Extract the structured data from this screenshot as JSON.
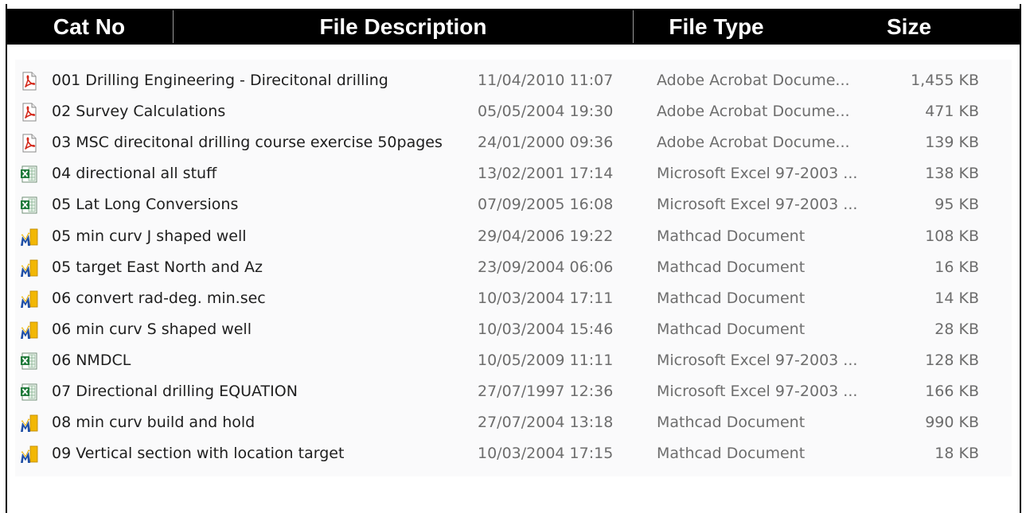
{
  "header": {
    "clipped_title": "",
    "columns": [
      "Cat No",
      "File Description",
      "File Type",
      "Size"
    ]
  },
  "files": [
    {
      "icon": "pdf-icon",
      "name": "001 Drilling Engineering - Direcitonal drilling",
      "date": "11/04/2010 11:07",
      "type": "Adobe Acrobat Docume...",
      "size": "1,455 KB"
    },
    {
      "icon": "pdf-icon",
      "name": "02 Survey Calculations",
      "date": "05/05/2004 19:30",
      "type": "Adobe Acrobat Docume...",
      "size": "471 KB"
    },
    {
      "icon": "pdf-icon",
      "name": "03 MSC direcitonal drilling course exercise 50pages",
      "date": "24/01/2000 09:36",
      "type": "Adobe Acrobat Docume...",
      "size": "139 KB"
    },
    {
      "icon": "excel-icon",
      "name": "04 directional all stuff",
      "date": "13/02/2001 17:14",
      "type": "Microsoft Excel 97-2003 ...",
      "size": "138 KB"
    },
    {
      "icon": "excel-icon",
      "name": "05 Lat Long Conversions",
      "date": "07/09/2005 16:08",
      "type": "Microsoft Excel 97-2003 ...",
      "size": "95 KB"
    },
    {
      "icon": "mathcad-icon",
      "name": "05 min curv J shaped well",
      "date": "29/04/2006 19:22",
      "type": "Mathcad Document",
      "size": "108 KB"
    },
    {
      "icon": "mathcad-icon",
      "name": "05 target East North and Az",
      "date": "23/09/2004 06:06",
      "type": "Mathcad Document",
      "size": "16 KB"
    },
    {
      "icon": "mathcad-icon",
      "name": "06 convert rad-deg. min.sec",
      "date": "10/03/2004 17:11",
      "type": "Mathcad Document",
      "size": "14 KB"
    },
    {
      "icon": "mathcad-icon",
      "name": "06 min curv S shaped well",
      "date": "10/03/2004 15:46",
      "type": "Mathcad Document",
      "size": "28 KB"
    },
    {
      "icon": "excel-icon",
      "name": "06 NMDCL",
      "date": "10/05/2009 11:11",
      "type": "Microsoft Excel 97-2003 ...",
      "size": "128 KB"
    },
    {
      "icon": "excel-icon",
      "name": "07 Directional drilling  EQUATION",
      "date": "27/07/1997 12:36",
      "type": "Microsoft Excel 97-2003 ...",
      "size": "166 KB"
    },
    {
      "icon": "mathcad-icon",
      "name": "08 min curv build and hold",
      "date": "27/07/2004 13:18",
      "type": "Mathcad Document",
      "size": "990 KB"
    },
    {
      "icon": "mathcad-icon",
      "name": "09 Vertical section with location target",
      "date": "10/03/2004 17:15",
      "type": "Mathcad Document",
      "size": "18 KB"
    }
  ],
  "colors": {
    "header_bg": "#000000",
    "header_text": "#ffffff",
    "pdf_red": "#d42a1c",
    "excel_green": "#1f7a3a",
    "mathcad_yellow": "#f2b705",
    "mathcad_blue": "#1f4fa6"
  }
}
